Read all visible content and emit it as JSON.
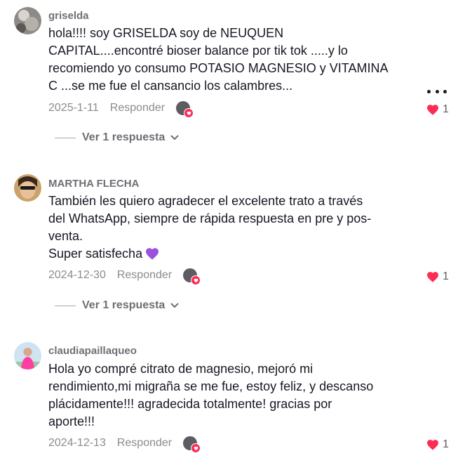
{
  "comments": [
    {
      "username": "griselda",
      "lines": [
        "hola!!!! soy GRISELDA soy de NEUQUEN",
        "CAPITAL....encontré bioser balance por tik tok .....y lo",
        "recomiendo yo consumo POTASIO MAGNESIO y VITAMINA",
        "C ...se me fue el cansancio los calambres..."
      ],
      "date": "2025-1-11",
      "reply_label": "Responder",
      "likes": "1",
      "view_replies": "Ver 1 respuesta"
    },
    {
      "username": "MARTHA FLECHA",
      "lines": [
        "También les quiero agradecer el excelente trato a través",
        "del WhatsApp, siempre de rápida respuesta en pre y pos-",
        "venta.",
        "Super satisfecha"
      ],
      "emoji": "purple-heart",
      "date": "2024-12-30",
      "reply_label": "Responder",
      "likes": "1",
      "view_replies": "Ver 1 respuesta"
    },
    {
      "username": "claudiapaillaqueo",
      "lines": [
        "Hola yo compré citrato de magnesio, mejoró mi",
        "rendimiento,mi migraña se me fue, estoy feliz, y descanso",
        "plácidamente!!! agradecida totalmente! gracias por",
        "aporte!!!"
      ],
      "date": "2024-12-13",
      "reply_label": "Responder",
      "likes": "1"
    }
  ],
  "colors": {
    "like_red": "#fe2c55",
    "text_primary": "#161823",
    "text_secondary": "#8a8b91",
    "emoji_purple": "#9b51e0"
  },
  "icons": [
    "more-options-icon",
    "heart-icon",
    "chevron-down-icon",
    "creator-liked-icon",
    "purple-heart-emoji"
  ]
}
